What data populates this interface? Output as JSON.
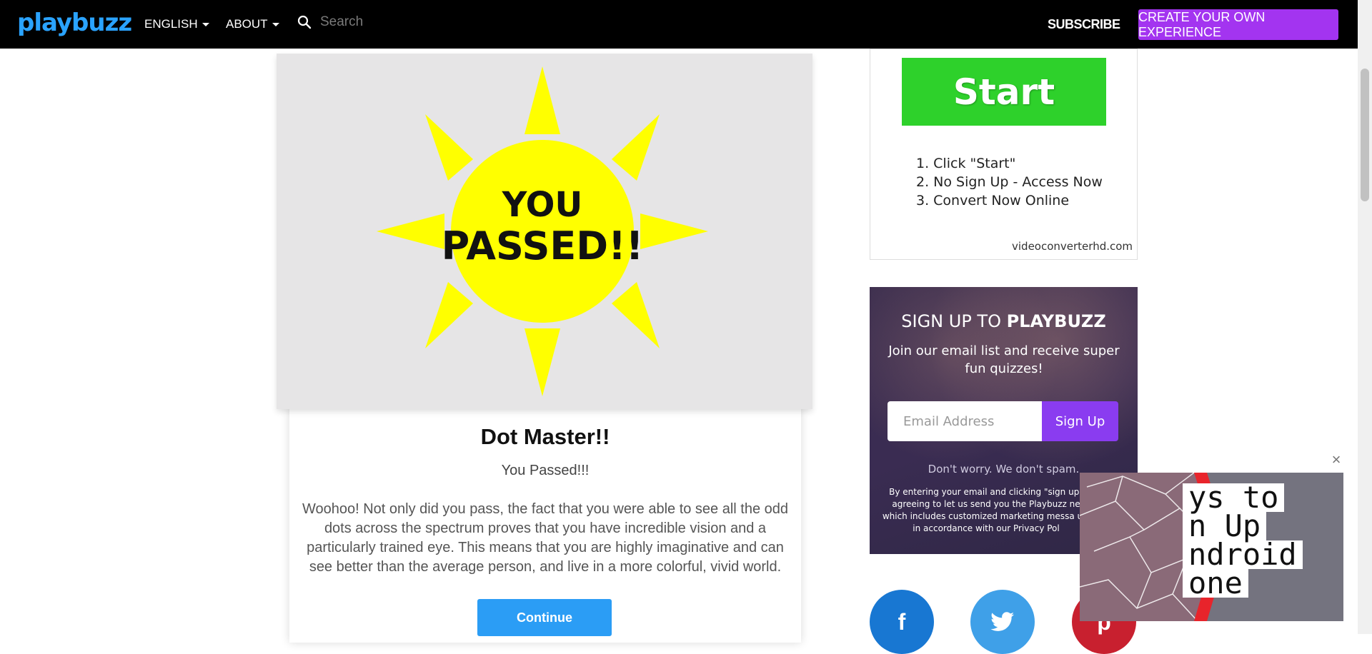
{
  "header": {
    "logo": "playbuzz",
    "language_label": "ENGLISH",
    "about_label": "ABOUT",
    "search_placeholder": "Search",
    "subscribe_label": "SUBSCRIBE",
    "create_label": "CREATE YOUR OWN EXPERIENCE"
  },
  "hero": {
    "text_line1": "YOU",
    "text_line2": "PASSED!!"
  },
  "result": {
    "title": "Dot Master!!",
    "subtitle": "You Passed!!!",
    "body": "Woohoo! Not only did you pass, the fact that you were able to see all the odd dots across the spectrum proves that you have incredible vision and a particularly trained eye. This means that you are highly imaginative and can see better than the average person, and live in a more colorful, vivid world.",
    "continue_label": "Continue"
  },
  "ad": {
    "start_label": "Start",
    "steps": [
      "1.  Click \"Start\"",
      "2. No Sign Up - Access Now",
      "3. Convert Now Online"
    ],
    "domain": "videoconverterhd.com"
  },
  "signup": {
    "title_prefix": "SIGN UP TO ",
    "title_brand": "PLAYBUZZ",
    "description": "Join our email list and receive super fun quizzes!",
    "email_placeholder": "Email Address",
    "button_label": "Sign Up",
    "no_spam": "Don't worry. We don't spam.",
    "legal": "By entering your email and clicking \"sign up\" agreeing to let us send you the Playbuzz ne which includes customized marketing messa us, in accordance with our Privacy Pol"
  },
  "video_ad": {
    "lines": [
      "ys to",
      "n Up",
      "ndroid",
      "one"
    ]
  },
  "colors": {
    "brand_blue": "#2aa3ff",
    "create_purple": "#a334f0",
    "continue_blue": "#2b9df5",
    "sun_yellow": "#ffff00"
  }
}
